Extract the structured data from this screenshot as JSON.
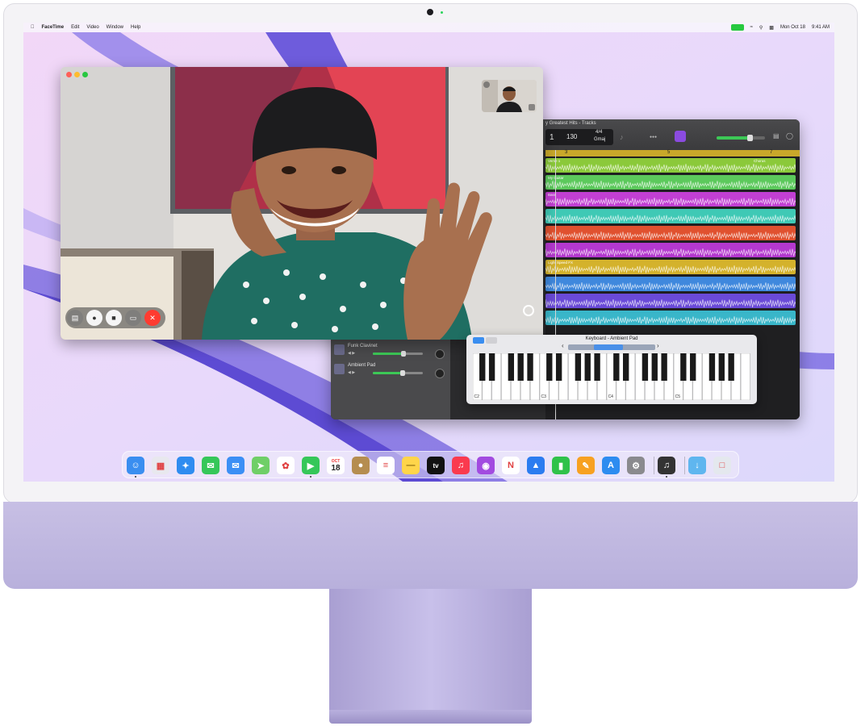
{
  "menubar": {
    "apple_icon": "apple-icon",
    "items": [
      "FaceTime",
      "Edit",
      "Video",
      "Window",
      "Help"
    ],
    "date": "Mon Oct 18",
    "time": "9:41 AM"
  },
  "garageband": {
    "title": "y Greatest Hits - Tracks",
    "lcd": {
      "bar": "1",
      "tempo": "130",
      "time_sig": "4/4",
      "key": "Gmaj"
    },
    "ruler_marks": [
      "3",
      "5",
      "7"
    ],
    "regions": [
      {
        "label": "Verse 1",
        "label2": "Chorus",
        "color": "#8bc93a"
      },
      {
        "label": "My Guitar",
        "color": "#5cc95c"
      },
      {
        "label": "Bass",
        "color": "#c23fd3"
      },
      {
        "label": "",
        "color": "#3fc9b5"
      },
      {
        "label": "",
        "color": "#e0512f"
      },
      {
        "label": "",
        "color": "#b438cf"
      },
      {
        "label": "Light Speed FX",
        "color": "#d4b22c"
      },
      {
        "label": "",
        "color": "#3f88dd"
      },
      {
        "label": "",
        "color": "#6a4ad8"
      },
      {
        "label": "",
        "color": "#39b6c9"
      }
    ],
    "track_headers": [
      {
        "name": "Funk Clavinet",
        "volume": 0.62
      },
      {
        "name": "Ambient Pad",
        "volume": 0.6
      }
    ]
  },
  "keyboard": {
    "title": "Keyboard - Ambient Pad",
    "octave_labels": [
      "C2",
      "C3",
      "C4",
      "C5"
    ]
  },
  "dock": {
    "apps": [
      {
        "name": "finder",
        "color": "#3a8ef0"
      },
      {
        "name": "launchpad",
        "color": "#e8e8ee"
      },
      {
        "name": "safari",
        "color": "#2f8cf0"
      },
      {
        "name": "messages",
        "color": "#35c759"
      },
      {
        "name": "mail",
        "color": "#3b8ff5"
      },
      {
        "name": "maps",
        "color": "#6fcf67"
      },
      {
        "name": "photos",
        "color": "#ffffff"
      },
      {
        "name": "facetime",
        "color": "#35c759"
      },
      {
        "name": "calendar",
        "color": "#ffffff",
        "month": "OCT",
        "day": "18"
      },
      {
        "name": "contacts",
        "color": "#b58d50"
      },
      {
        "name": "reminders",
        "color": "#ffffff"
      },
      {
        "name": "notes",
        "color": "#ffd54a"
      },
      {
        "name": "tv",
        "color": "#111111",
        "label": "tv"
      },
      {
        "name": "music",
        "color": "#fa3a4e"
      },
      {
        "name": "podcasts",
        "color": "#a24be0"
      },
      {
        "name": "news",
        "color": "#ffffff"
      },
      {
        "name": "keynote",
        "color": "#2b7cf0"
      },
      {
        "name": "numbers",
        "color": "#2fc24a"
      },
      {
        "name": "pages",
        "color": "#f7a121"
      },
      {
        "name": "app-store",
        "color": "#2d8cf0"
      },
      {
        "name": "system-preferences",
        "color": "#8a8a8e"
      },
      {
        "name": "garageband",
        "color": "#333333"
      },
      {
        "name": "downloads-folder",
        "color": "#5fb6ef"
      },
      {
        "name": "trash",
        "color": "#e4e8ee"
      }
    ]
  }
}
